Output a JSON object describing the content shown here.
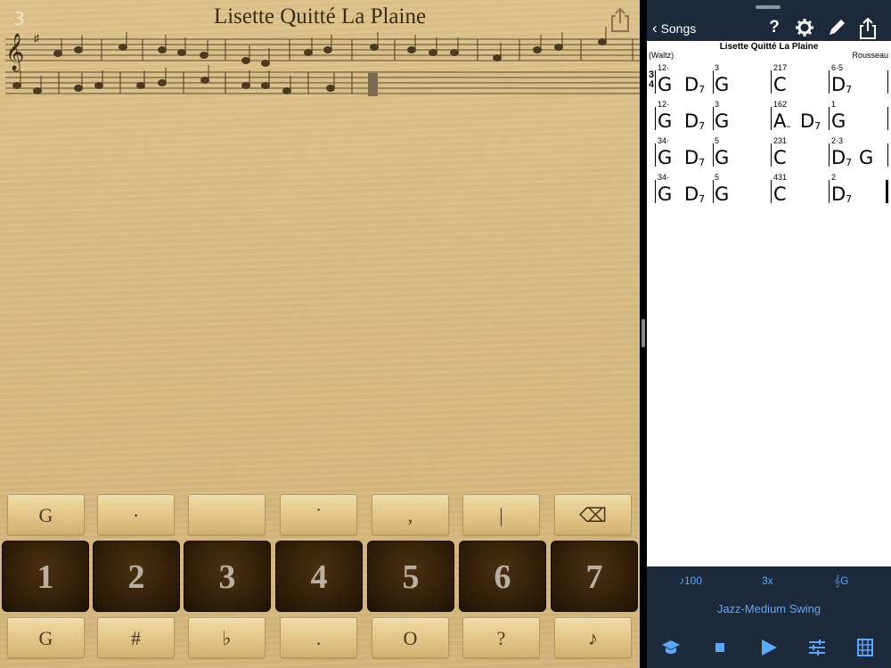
{
  "left": {
    "page_number": "3",
    "title": "Lisette Quitté La Plaine",
    "share_icon": "share-icon"
  },
  "keypad": {
    "top_row": [
      "G",
      "·",
      "",
      "˙",
      ",",
      "|",
      "⌫"
    ],
    "number_row": [
      "1",
      "2",
      "3",
      "4",
      "5",
      "6",
      "7"
    ],
    "bottom_row": [
      "G",
      "#",
      "♭",
      ".",
      "O",
      "?",
      "♪"
    ]
  },
  "right": {
    "back_label": "Songs",
    "nav_icons": [
      "help-icon",
      "settings-icon",
      "edit-icon",
      "share-icon"
    ],
    "help_glyph": "?",
    "chart_title": "Lisette Quitté La Plaine",
    "style": "(Waltz)",
    "composer": "Rousseau",
    "time_signature": "3/4",
    "rows": [
      [
        {
          "fing": "12·",
          "chord": "G",
          "sub": ""
        },
        {
          "fing": "",
          "chord": "D",
          "sub": "7"
        },
        {
          "fing": "3",
          "chord": "G",
          "sub": ""
        },
        {
          "fing": "217̇",
          "chord": "C",
          "sub": ""
        },
        {
          "fing": "6·5",
          "chord": "D",
          "sub": "7"
        }
      ],
      [
        {
          "fing": "12·",
          "chord": "G",
          "sub": ""
        },
        {
          "fing": "",
          "chord": "D",
          "sub": "7"
        },
        {
          "fing": "3",
          "chord": "G",
          "sub": ""
        },
        {
          "fing": "162̇",
          "chord": "A",
          "sub": "–"
        },
        {
          "fing": "",
          "chord": "D",
          "sub": "7"
        },
        {
          "fing": "1",
          "chord": "G",
          "sub": ""
        }
      ],
      [
        {
          "fing": "34·",
          "chord": "G",
          "sub": ""
        },
        {
          "fing": "",
          "chord": "D",
          "sub": "7"
        },
        {
          "fing": "5",
          "chord": "G",
          "sub": ""
        },
        {
          "fing": "231",
          "chord": "C",
          "sub": ""
        },
        {
          "fing": "2·3",
          "chord": "D",
          "sub": "7"
        },
        {
          "fing": "",
          "chord": "G",
          "sub": ""
        }
      ],
      [
        {
          "fing": "34·",
          "chord": "G",
          "sub": ""
        },
        {
          "fing": "",
          "chord": "D",
          "sub": "7"
        },
        {
          "fing": "5",
          "chord": "G",
          "sub": ""
        },
        {
          "fing": "431",
          "chord": "C",
          "sub": ""
        },
        {
          "fing": "2",
          "chord": "D",
          "sub": "7"
        }
      ]
    ],
    "tempo": "100",
    "repeats": "3x",
    "key": "G",
    "style_name": "Jazz-Medium Swing",
    "bottom_icons": [
      "practice-icon",
      "stop-icon",
      "play-icon",
      "mixer-icon",
      "chord-grid-icon"
    ]
  },
  "colors": {
    "nav_bg": "#1c2a3c",
    "accent": "#5aa8ff",
    "wood": "#d9bd85"
  }
}
